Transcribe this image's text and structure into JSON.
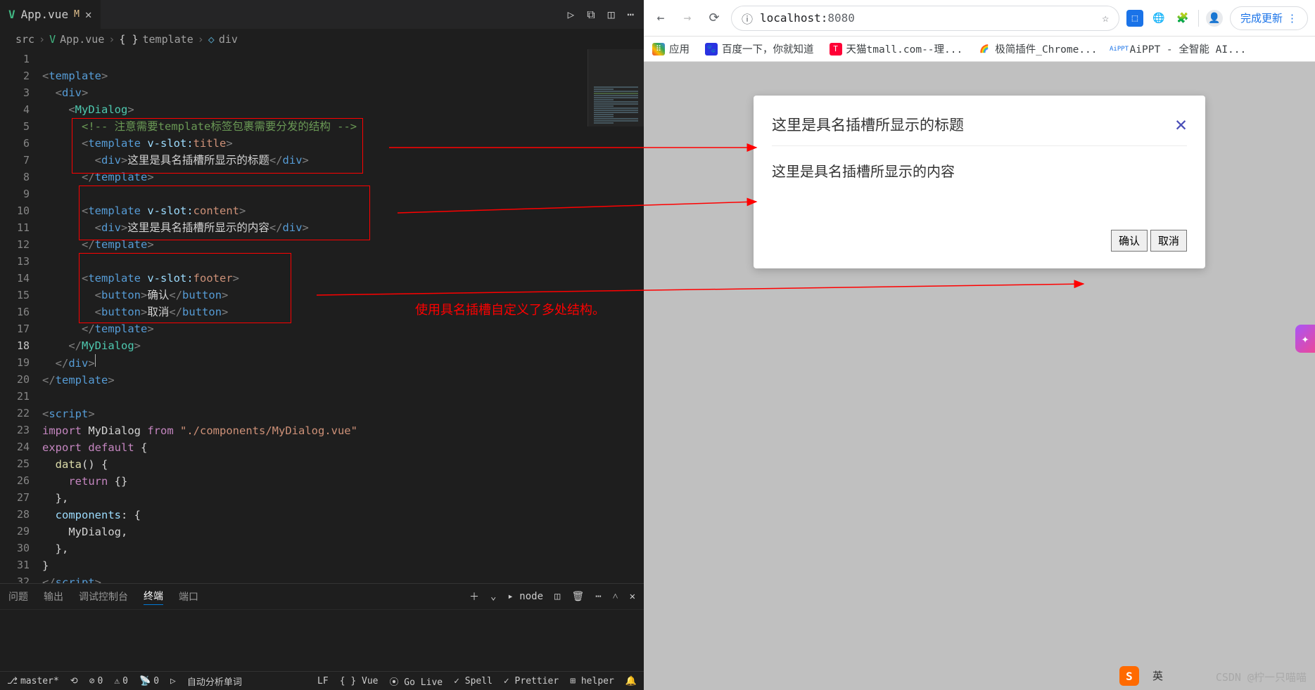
{
  "editor": {
    "tab": {
      "file": "App.vue",
      "modified": "M"
    },
    "breadcrumbs": [
      "src",
      "App.vue",
      "template",
      "div"
    ],
    "lines": {
      "l1": {
        "tag": "template"
      },
      "l2": {
        "tag": "div"
      },
      "l3": {
        "tag": "MyDialog"
      },
      "l4": {
        "comment": "<!-- 注意需要template标签包裹需要分发的结构 -->"
      },
      "l5": {
        "el": "template",
        "attr": "v-slot:",
        "val": "title"
      },
      "l6": {
        "el": "div",
        "text": "这里是具名插槽所显示的标题"
      },
      "l7": {
        "close": "template"
      },
      "l9": {
        "el": "template",
        "attr": "v-slot:",
        "val": "content"
      },
      "l10": {
        "el": "div",
        "text": "这里是具名插槽所显示的内容"
      },
      "l11": {
        "close": "template"
      },
      "l13": {
        "el": "template",
        "attr": "v-slot:",
        "val": "footer"
      },
      "l14": {
        "el": "button",
        "text": "确认"
      },
      "l15": {
        "el": "button",
        "text": "取消"
      },
      "l16": {
        "close": "template"
      },
      "l17": {
        "close": "MyDialog"
      },
      "l18": {
        "close": "div"
      },
      "l19": {
        "close": "template"
      },
      "l21": {
        "tag": "script"
      },
      "l22": {
        "kw1": "import",
        "id": "MyDialog",
        "kw2": "from",
        "str": "\"./components/MyDialog.vue\""
      },
      "l23": {
        "kw1": "export",
        "kw2": "default"
      },
      "l24": {
        "fn": "data"
      },
      "l25": {
        "kw": "return"
      },
      "l27": {
        "prop": "components"
      },
      "l28": {
        "id": "MyDialog"
      },
      "l31": {
        "close": "script"
      }
    },
    "annotation": "使用具名插槽自定义了多处结构。"
  },
  "panel": {
    "tabs": [
      "问题",
      "输出",
      "调试控制台",
      "终端",
      "端口"
    ],
    "active": 3,
    "right": {
      "shell": "node"
    }
  },
  "statusbar": {
    "branch": "master*",
    "errors": "0",
    "warnings": "0",
    "ports": "0",
    "extra": "自动分析单词",
    "right": [
      "LF",
      "{ } Vue",
      "⦿ Go Live",
      "✓ Spell",
      "✓ Prettier",
      "⊞ helper"
    ]
  },
  "browser": {
    "url_host": "localhost:",
    "url_port": "8080",
    "update": "完成更新",
    "bookmarks": [
      {
        "label": "应用",
        "color": "#ea4335"
      },
      {
        "label": "百度一下，你就知道",
        "color": "#2932e1"
      },
      {
        "label": "天猫tmall.com--理...",
        "color": "#ff0036"
      },
      {
        "label": "极简插件_Chrome...",
        "color": "#ff9800"
      },
      {
        "label": "AiPPT - 全智能 AI...",
        "color": "#1a73e8"
      }
    ],
    "dialog": {
      "title": "这里是具名插槽所显示的标题",
      "content": "这里是具名插槽所显示的内容",
      "confirm": "确认",
      "cancel": "取消"
    },
    "watermark": "CSDN @柠一只喵喵",
    "ime": "英"
  }
}
